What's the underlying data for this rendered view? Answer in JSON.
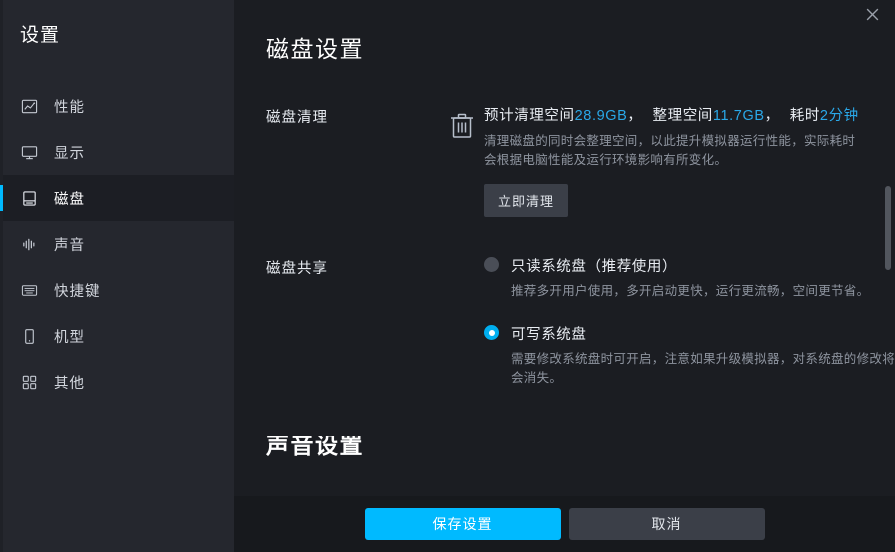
{
  "sidebar": {
    "title": "设置",
    "items": [
      {
        "label": "性能",
        "icon": "performance-chart-icon",
        "active": false
      },
      {
        "label": "显示",
        "icon": "monitor-icon",
        "active": false
      },
      {
        "label": "磁盘",
        "icon": "disk-icon",
        "active": true
      },
      {
        "label": "声音",
        "icon": "sound-wave-icon",
        "active": false
      },
      {
        "label": "快捷键",
        "icon": "keyboard-icon",
        "active": false
      },
      {
        "label": "机型",
        "icon": "phone-icon",
        "active": false
      },
      {
        "label": "其他",
        "icon": "grid-squares-icon",
        "active": false
      }
    ]
  },
  "titlebar": {
    "close_label": "✕"
  },
  "main": {
    "page_title": "磁盘设置",
    "disk_clean": {
      "label": "磁盘清理",
      "icon": "trash-icon",
      "headline_prefix": "预计清理空间",
      "headline_value_1": "28.9GB",
      "headline_sep_1": "，",
      "headline_mid": "整理空间",
      "headline_value_2": "11.7GB",
      "headline_sep_2": "，",
      "headline_suffix": "耗时",
      "headline_value_3": "2分钟",
      "description": "清理磁盘的同时会整理空间，以此提升模拟器运行性能，实际耗时会根据电脑性能及运行环境影响有所变化。",
      "button_label": "立即清理"
    },
    "disk_share": {
      "label": "磁盘共享",
      "options": [
        {
          "label": "只读系统盘（推荐使用）",
          "description": "推荐多开用户使用，多开启动更快，运行更流畅，空间更节省。",
          "selected": false
        },
        {
          "label": "可写系统盘",
          "description": "需要修改系统盘时可开启，注意如果升级模拟器，对系统盘的修改将会消失。",
          "selected": true
        }
      ]
    },
    "next_section_title": "声音设置"
  },
  "footer": {
    "save_label": "保存设置",
    "cancel_label": "取消"
  },
  "colors": {
    "accent": "#00baff",
    "link_value": "#2aa8e8",
    "sidebar_bg": "#25272e",
    "main_bg": "#1b1d22",
    "footer_bg": "#17191d",
    "active_item_bg": "#1c1e24",
    "muted_text": "#8e949f",
    "button_secondary": "#3b3f48"
  }
}
